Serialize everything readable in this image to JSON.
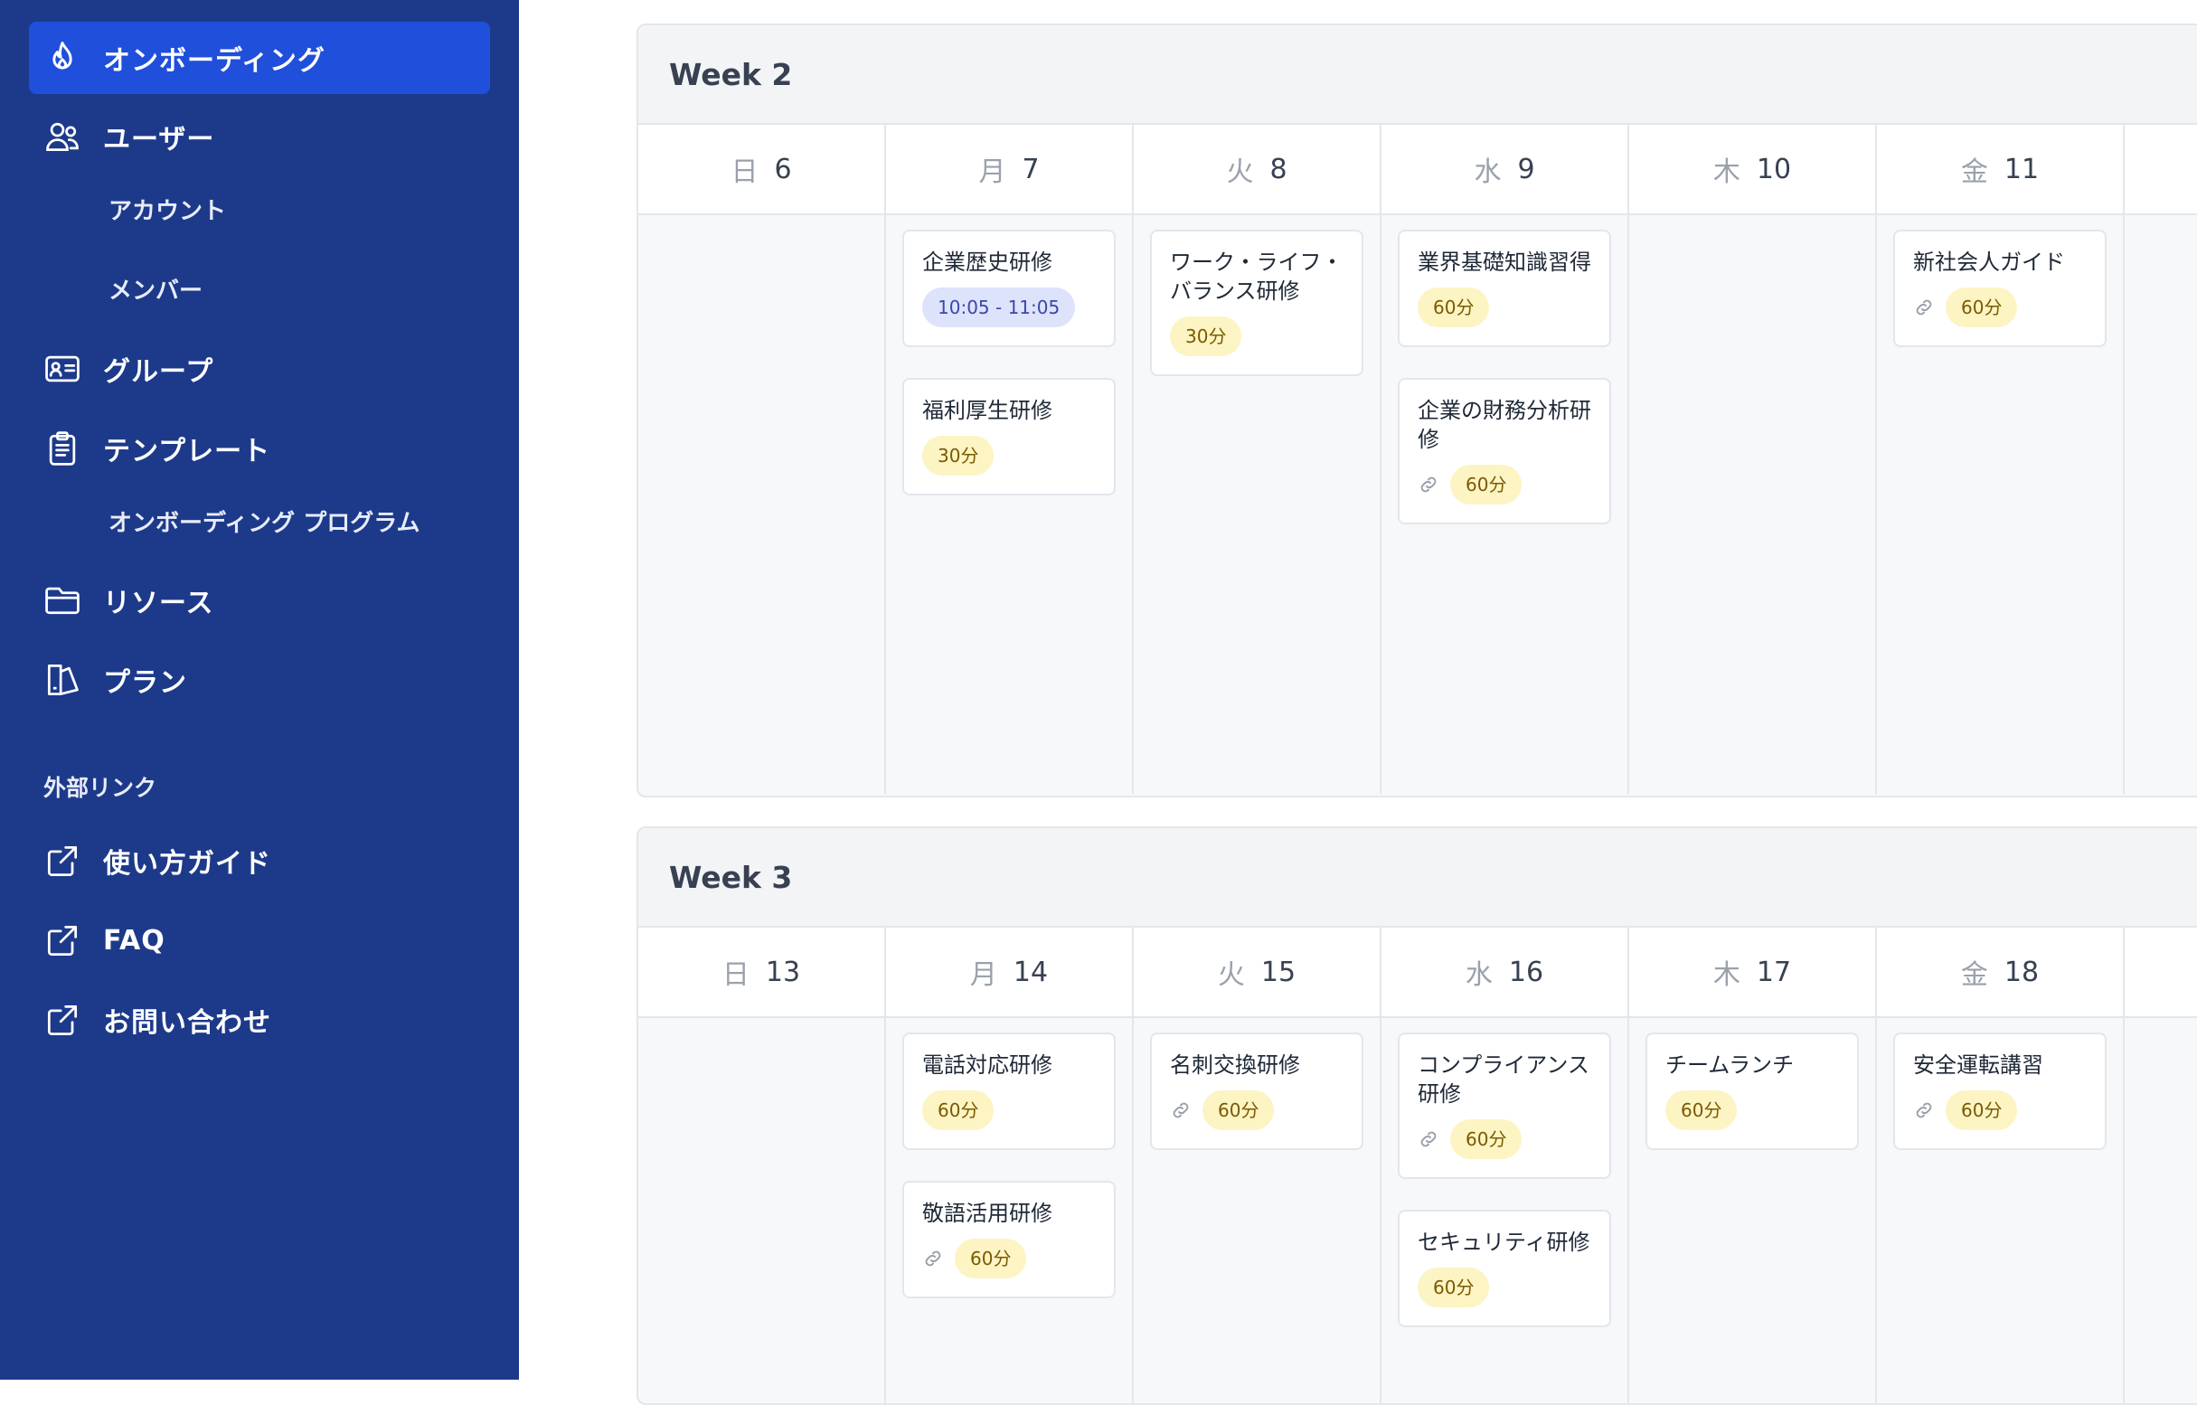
{
  "sidebar": {
    "items": [
      {
        "label": "オンボーディング",
        "icon": "flame-icon",
        "active": true
      },
      {
        "label": "ユーザー",
        "icon": "users-icon"
      },
      {
        "label": "グループ",
        "icon": "id-card-icon"
      },
      {
        "label": "テンプレート",
        "icon": "clipboard-icon"
      },
      {
        "label": "リソース",
        "icon": "folder-icon"
      },
      {
        "label": "プラン",
        "icon": "plan-icon"
      }
    ],
    "sub_users": [
      "アカウント",
      "メンバー"
    ],
    "sub_templates": [
      "オンボーディング プログラム"
    ],
    "external_section_label": "外部リンク",
    "external_links": [
      {
        "label": "使い方ガイド",
        "icon": "external-link-icon"
      },
      {
        "label": "FAQ",
        "icon": "external-link-icon"
      },
      {
        "label": "お問い合わせ",
        "icon": "external-link-icon"
      }
    ]
  },
  "weeks": [
    {
      "title": "Week 2",
      "days": [
        {
          "name": "日",
          "date": "6"
        },
        {
          "name": "月",
          "date": "7"
        },
        {
          "name": "火",
          "date": "8"
        },
        {
          "name": "水",
          "date": "9"
        },
        {
          "name": "木",
          "date": "10"
        },
        {
          "name": "金",
          "date": "11"
        },
        {
          "name": "",
          "date": ""
        }
      ],
      "columns": [
        [],
        [
          {
            "title": "企業歴史研修",
            "badge": "10:05 - 11:05",
            "badge_style": "blue",
            "link": false
          },
          {
            "title": "福利厚生研修",
            "badge": "30分",
            "badge_style": "yellow",
            "link": false
          }
        ],
        [
          {
            "title": "ワーク・ライフ・バランス研修",
            "badge": "30分",
            "badge_style": "yellow",
            "link": false
          }
        ],
        [
          {
            "title": "業界基礎知識習得",
            "badge": "60分",
            "badge_style": "yellow",
            "link": false
          },
          {
            "title": "企業の財務分析研修",
            "badge": "60分",
            "badge_style": "yellow",
            "link": true
          }
        ],
        [],
        [
          {
            "title": "新社会人ガイド",
            "badge": "60分",
            "badge_style": "yellow",
            "link": true
          }
        ],
        []
      ]
    },
    {
      "title": "Week 3",
      "days": [
        {
          "name": "日",
          "date": "13"
        },
        {
          "name": "月",
          "date": "14"
        },
        {
          "name": "火",
          "date": "15"
        },
        {
          "name": "水",
          "date": "16"
        },
        {
          "name": "木",
          "date": "17"
        },
        {
          "name": "金",
          "date": "18"
        },
        {
          "name": "",
          "date": ""
        }
      ],
      "columns": [
        [],
        [
          {
            "title": "電話対応研修",
            "badge": "60分",
            "badge_style": "yellow",
            "link": false
          },
          {
            "title": "敬語活用研修",
            "badge": "60分",
            "badge_style": "yellow",
            "link": true
          }
        ],
        [
          {
            "title": "名刺交換研修",
            "badge": "60分",
            "badge_style": "yellow",
            "link": true
          }
        ],
        [
          {
            "title": "コンプライアンス研修",
            "badge": "60分",
            "badge_style": "yellow",
            "link": true
          },
          {
            "title": "セキュリティ研修",
            "badge": "60分",
            "badge_style": "yellow",
            "link": false
          }
        ],
        [
          {
            "title": "チームランチ",
            "badge": "60分",
            "badge_style": "yellow",
            "link": false
          }
        ],
        [
          {
            "title": "安全運転講習",
            "badge": "60分",
            "badge_style": "yellow",
            "link": true
          }
        ],
        []
      ]
    }
  ],
  "colors": {
    "sidebar": "#1d3a8a",
    "active": "#1f4fdb",
    "badge_yellow": "#fdf4c4",
    "badge_blue": "#dde3fb"
  }
}
